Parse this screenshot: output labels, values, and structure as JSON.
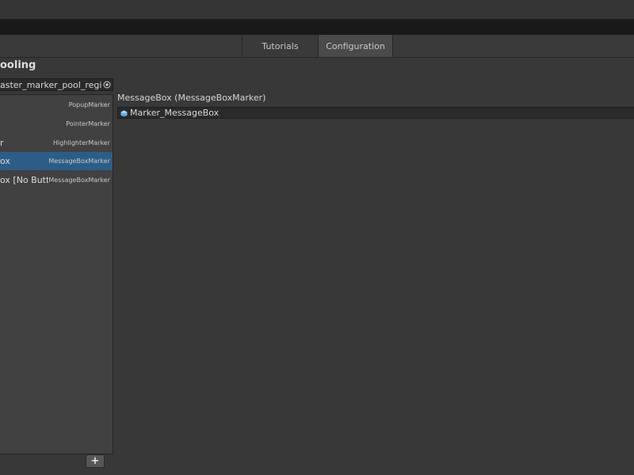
{
  "tabs": [
    {
      "label": "Tutorials",
      "active": false
    },
    {
      "label": "Configuration",
      "active": true
    }
  ],
  "section_title": "ooling",
  "registry": {
    "value": "aster_marker_pool_registry (",
    "picker_icon": "object-picker-icon"
  },
  "list": {
    "items": [
      {
        "name": "",
        "type": "PopupMarker",
        "selected": false
      },
      {
        "name": "",
        "type": "PointerMarker",
        "selected": false
      },
      {
        "name": "r",
        "type": "HighlighterMarker",
        "selected": false
      },
      {
        "name": "ox",
        "type": "MessageBoxMarker",
        "selected": true
      },
      {
        "name": "ox [No Button]",
        "type": "MessageBoxMarker",
        "selected": false
      }
    ],
    "add_label": "+"
  },
  "detail": {
    "header": "MessageBox (MessageBoxMarker)",
    "object_field": "Marker_MessageBox",
    "object_icon": "prefab-icon"
  },
  "colors": {
    "selection": "#2c5d87",
    "panel": "#414141",
    "background": "#383838"
  }
}
